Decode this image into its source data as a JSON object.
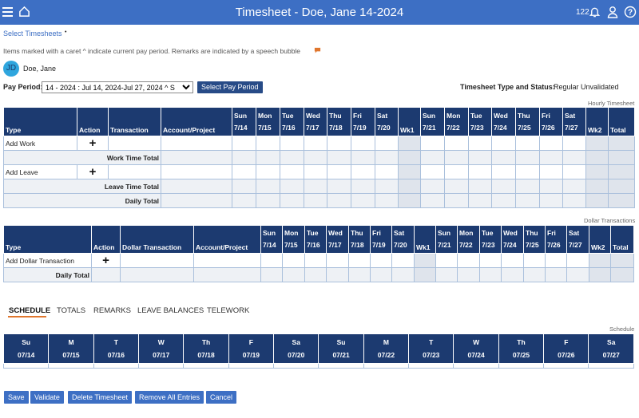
{
  "header": {
    "title": "Timesheet - Doe, Jane 14-2024",
    "notif_count": "122"
  },
  "nav": {
    "select_timesheets": "Select Timesheets",
    "caret": "•"
  },
  "info_text": "Items marked with a caret ^ indicate current pay period. Remarks are indicated by a speech bubble",
  "user": {
    "initials": "JD",
    "name": "Doe, Jane"
  },
  "pay_period": {
    "label": "Pay Period:",
    "selected": "14 - 2024 : Jul 14, 2024-Jul 27, 2024 ^ S",
    "button": "Select Pay Period"
  },
  "status": {
    "label": "Timesheet Type and Status:",
    "value": "Regular Unvalidated"
  },
  "hourly": {
    "caption": "Hourly Timesheet",
    "headers": {
      "type": "Type",
      "action": "Action",
      "transaction": "Transaction",
      "account": "Account/Project",
      "wk1": "Wk1",
      "wk2": "Wk2",
      "total": "Total"
    },
    "days1": [
      [
        "Sun",
        "7/14"
      ],
      [
        "Mon",
        "7/15"
      ],
      [
        "Tue",
        "7/16"
      ],
      [
        "Wed",
        "7/17"
      ],
      [
        "Thu",
        "7/18"
      ],
      [
        "Fri",
        "7/19"
      ],
      [
        "Sat",
        "7/20"
      ]
    ],
    "days2": [
      [
        "Sun",
        "7/21"
      ],
      [
        "Mon",
        "7/22"
      ],
      [
        "Tue",
        "7/23"
      ],
      [
        "Wed",
        "7/24"
      ],
      [
        "Thu",
        "7/25"
      ],
      [
        "Fri",
        "7/26"
      ],
      [
        "Sat",
        "7/27"
      ]
    ],
    "rows": {
      "add_work": "Add Work",
      "work_total": "Work Time Total",
      "add_leave": "Add Leave",
      "leave_total": "Leave Time Total",
      "daily_total": "Daily Total"
    },
    "plus": "+"
  },
  "dollar": {
    "caption": "Dollar Transactions",
    "headers": {
      "type": "Type",
      "action": "Action",
      "transaction": "Dollar Transaction",
      "account": "Account/Project",
      "wk1": "Wk1",
      "wk2": "Wk2",
      "total": "Total"
    },
    "rows": {
      "add": "Add Dollar Transaction",
      "daily_total": "Daily Total"
    },
    "plus": "+"
  },
  "tabs": [
    "SCHEDULE",
    "TOTALS",
    "REMARKS",
    "LEAVE BALANCES",
    "TELEWORK"
  ],
  "schedule": {
    "caption": "Schedule",
    "days": [
      [
        "Su",
        "07/14"
      ],
      [
        "M",
        "07/15"
      ],
      [
        "T",
        "07/16"
      ],
      [
        "W",
        "07/17"
      ],
      [
        "Th",
        "07/18"
      ],
      [
        "F",
        "07/19"
      ],
      [
        "Sa",
        "07/20"
      ],
      [
        "Su",
        "07/21"
      ],
      [
        "M",
        "07/22"
      ],
      [
        "T",
        "07/23"
      ],
      [
        "W",
        "07/24"
      ],
      [
        "Th",
        "07/25"
      ],
      [
        "F",
        "07/26"
      ],
      [
        "Sa",
        "07/27"
      ]
    ]
  },
  "actions": {
    "save": "Save",
    "validate": "Validate",
    "delete": "Delete Timesheet",
    "remove": "Remove All Entries",
    "cancel": "Cancel"
  },
  "colors": {
    "header": "#3d6fc4",
    "table_header": "#1c3a70",
    "accent": "#e0762d"
  }
}
